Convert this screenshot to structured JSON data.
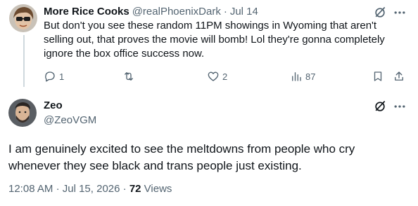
{
  "reply": {
    "author_name": "More Rice Cooks",
    "handle": "@realPhoenixDark",
    "separator": "·",
    "date": "Jul 14",
    "text": "But don't you see these random 11PM showings in Wyoming that aren't selling out, that proves the movie will bomb! Lol they're gonna completely ignore the box office success now.",
    "actions": {
      "replies": "1",
      "retweets": "",
      "likes": "2",
      "views": "87"
    }
  },
  "main": {
    "author_name": "Zeo",
    "handle": "@ZeoVGM",
    "text": "I am genuinely excited to see the meltdowns from people who cry whenever they see black and trans people just existing.",
    "time": "12:08 AM",
    "separator": "·",
    "date": "Jul 15, 2026",
    "views_count": "72",
    "views_label": "Views"
  },
  "colors": {
    "text": "#0f1419",
    "muted": "#536471",
    "thread_line": "#cfd9de"
  },
  "icons": [
    "reply-icon",
    "retweet-icon",
    "like-icon",
    "views-icon",
    "bookmark-icon",
    "share-icon",
    "grok-icon",
    "more-icon"
  ]
}
